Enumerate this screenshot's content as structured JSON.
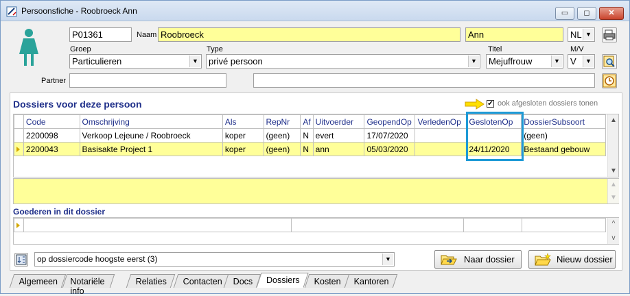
{
  "window": {
    "title": "Persoonsfiche - Roobroeck Ann",
    "min_label": "▭",
    "max_label": "◻",
    "close_label": "✕"
  },
  "person": {
    "id": "P01361",
    "naam_label": "Naam",
    "naam": "Roobroeck",
    "voornaam": "Ann",
    "taal": "NL",
    "groep_label": "Groep",
    "groep": "Particulieren",
    "type_label": "Type",
    "type": "privé persoon",
    "titel_label": "Titel",
    "titel": "Mejuffrouw",
    "mv_label": "M/V",
    "mv": "V",
    "partner_label": "Partner",
    "partner": "",
    "partner2": ""
  },
  "dossiers": {
    "title": "Dossiers voor deze persoon",
    "checkbox_label": "ook afgesloten dossiers tonen",
    "checkbox_checked": true,
    "columns": [
      "Code",
      "Omschrijving",
      "Als",
      "RepNr",
      "Af",
      "Uitvoerder",
      "GeopendOp",
      "VerledenOp",
      "GeslotenOp",
      "DossierSubsoort"
    ],
    "rows": [
      {
        "code": "2200098",
        "omschrijving": "Verkoop Lejeune / Roobroeck",
        "als": "koper",
        "repnr": "(geen)",
        "af": "N",
        "uitvoerder": "evert",
        "geopend": "17/07/2020",
        "verleden": "",
        "gesloten": "",
        "subsoort": "(geen)"
      },
      {
        "code": "2200043",
        "omschrijving": "Basisakte Project 1",
        "als": "koper",
        "repnr": "(geen)",
        "af": "N",
        "uitvoerder": "ann",
        "geopend": "05/03/2020",
        "verleden": "",
        "gesloten": "24/11/2020",
        "subsoort": "Bestaand gebouw"
      }
    ]
  },
  "goederen": {
    "title": "Goederen in dit dossier"
  },
  "sort": {
    "value": "op dossiercode hoogste eerst (3)"
  },
  "buttons": {
    "naar_dossier": "Naar dossier",
    "nieuw_dossier": "Nieuw dossier"
  },
  "tabs": [
    {
      "label": "Algemeen"
    },
    {
      "label": "Notariële info"
    },
    {
      "label": "Relaties"
    },
    {
      "label": "Contacten"
    },
    {
      "label": "Docs"
    },
    {
      "label": "Dossiers"
    },
    {
      "label": "Kosten"
    },
    {
      "label": "Kantoren"
    }
  ],
  "colors": {
    "accent_highlight": "#1e9ad6",
    "field_yellow": "#ffff99",
    "header_blue": "#1f2f8a",
    "arrow_yellow": "#ffe000"
  }
}
